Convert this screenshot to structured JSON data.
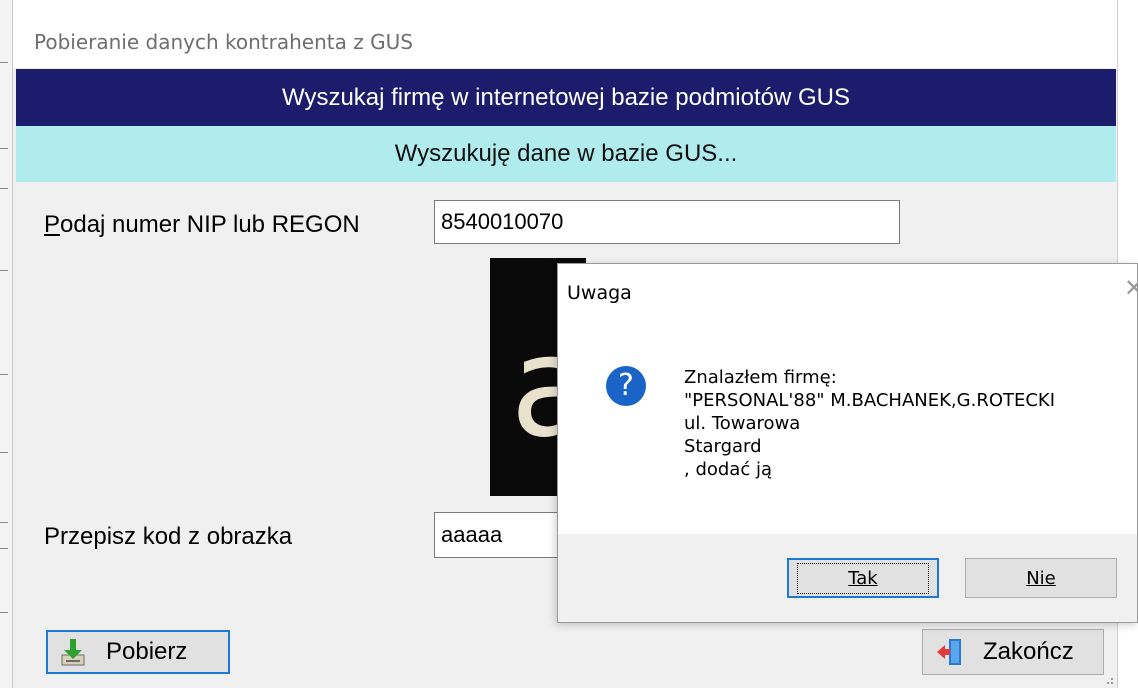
{
  "window": {
    "title": "Pobieranie danych kontrahenta z GUS"
  },
  "banners": {
    "header": "Wyszukaj firmę w internetowej bazie podmiotów GUS",
    "status": "Wyszukuję dane w bazie GUS..."
  },
  "form": {
    "nip_label_first": "P",
    "nip_label_rest": "odaj numer NIP lub REGON",
    "nip_value": "8540010070",
    "captcha_glyph": "a",
    "code_label": "Przepisz kod z obrazka",
    "code_value": "aaaaa"
  },
  "buttons": {
    "fetch": "Pobierz",
    "close": "Zakończ"
  },
  "dialog": {
    "title": "Uwaga",
    "icon": "question-icon",
    "message_lines": [
      "Znalazłem firmę:",
      "\"PERSONAL'88\" M.BACHANEK,G.ROTECKI",
      "ul. Towarowa",
      "Stargard",
      ", dodać ją"
    ],
    "yes": "Tak",
    "no": "Nie"
  },
  "colors": {
    "header_bg": "#1c1c6c",
    "status_bg": "#b0eced",
    "dialog_icon": "#1a64c8",
    "focus_border": "#1c7ad6"
  }
}
